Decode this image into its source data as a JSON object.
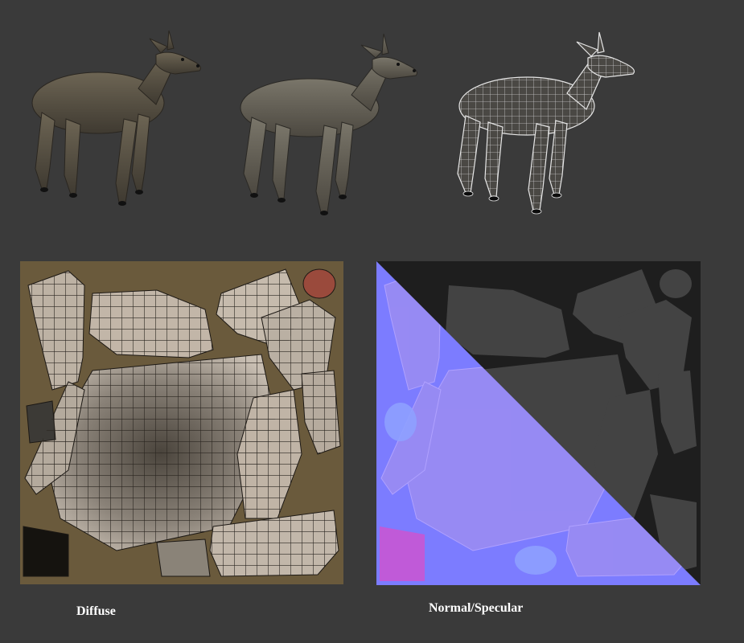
{
  "canvas": {
    "background": "#3a3a3a"
  },
  "models": [
    {
      "name": "deer-model-textured-dark",
      "style": "textured",
      "body_color": "#5a5244"
    },
    {
      "name": "deer-model-textured-grey",
      "style": "textured",
      "body_color": "#6a665c"
    },
    {
      "name": "deer-model-wireframe",
      "style": "wireframe",
      "body_color": "#4a4844"
    }
  ],
  "panels": {
    "diffuse": {
      "caption": "Diffuse",
      "background": "#6a5a3c",
      "island_color": "#b9aea2"
    },
    "normal_specular": {
      "caption": "Normal/Specular",
      "normal_color": "#7c7cff",
      "specular_color": "#1e1e1e"
    }
  }
}
